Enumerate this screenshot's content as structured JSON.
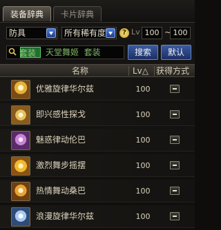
{
  "tabs": [
    {
      "label": "装备辞典",
      "active": true
    },
    {
      "label": "卡片辞典",
      "active": false
    }
  ],
  "filters": {
    "category": "防具",
    "rarity": "所有稀有度",
    "help_symbol": "?",
    "lv_label": "Lv",
    "lv_min": "100",
    "tilde": "~",
    "lv_max": "100"
  },
  "search": {
    "value": "套装",
    "placeholder_hint": "天堂舞姬  套装",
    "search_button": "搜索",
    "reset_button": "默认"
  },
  "table": {
    "columns": {
      "name": "名称",
      "level": "Lv△",
      "source": "获得方式"
    },
    "rows": [
      {
        "name": "优雅旋律华尔兹",
        "level": "100",
        "icon": "dance-armor-icon"
      },
      {
        "name": "即兴感性探戈",
        "level": "100",
        "icon": "dance-armor-icon"
      },
      {
        "name": "魅惑律动伦巴",
        "level": "100",
        "icon": "dance-armor-icon"
      },
      {
        "name": "激烈舞步摇摆",
        "level": "100",
        "icon": "dance-armor-icon"
      },
      {
        "name": "热情舞动桑巴",
        "level": "100",
        "icon": "dance-armor-icon"
      },
      {
        "name": "浪漫旋律华尔兹",
        "level": "100",
        "icon": "dance-armor-icon"
      }
    ]
  }
}
